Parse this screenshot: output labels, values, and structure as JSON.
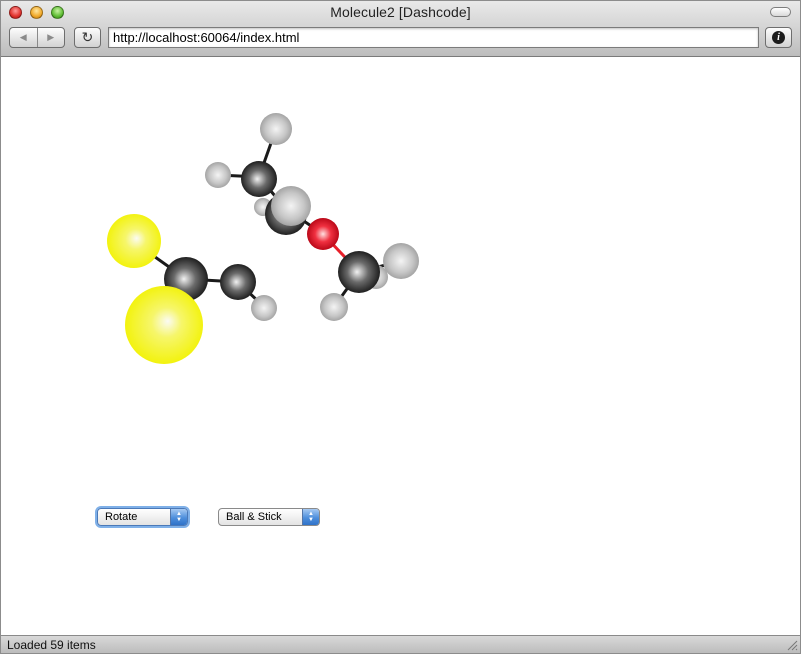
{
  "window": {
    "title": "Molecule2 [Dashcode]",
    "url": "http://localhost:60064/index.html"
  },
  "toolbar": {
    "back_icon": "back-arrow-icon",
    "forward_icon": "forward-arrow-icon",
    "reload_icon": "reload-icon",
    "info_icon": "info-icon",
    "info_glyph": "i"
  },
  "controls": {
    "mode_select": {
      "value": "Rotate"
    },
    "style_select": {
      "value": "Ball & Stick"
    }
  },
  "status": {
    "text": "Loaded 59 items"
  },
  "colors": {
    "sulfur": "#f4f40a",
    "carbon": "#2a2a2a",
    "hydrogen": "#b9b9b9",
    "oxygen": "#e8202a",
    "select_accent": "#4e8fdc"
  }
}
